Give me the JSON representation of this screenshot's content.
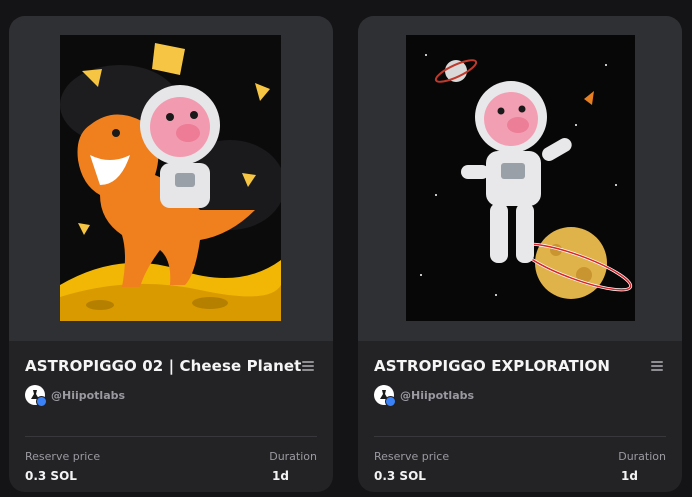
{
  "cards": [
    {
      "title": "ASTROPIGGO 02 | Cheese Planet",
      "creator": "@Hiipotlabs",
      "reserve_label": "Reserve price",
      "reserve_value": "0.3 SOL",
      "duration_label": "Duration",
      "duration_value": "1d"
    },
    {
      "title": "ASTROPIGGO EXPLORATION",
      "creator": "@Hiipotlabs",
      "reserve_label": "Reserve price",
      "reserve_value": "0.3 SOL",
      "duration_label": "Duration",
      "duration_value": "1d"
    }
  ],
  "colors": {
    "page_bg": "#141416",
    "card_bg": "#232326",
    "media_bg": "#2f3034",
    "text_primary": "#f3f3f4",
    "text_muted": "#9a9aa0",
    "verified": "#3b82f6"
  },
  "icons": {
    "menu": "hamburger-icon",
    "verified": "verified-badge-icon"
  }
}
